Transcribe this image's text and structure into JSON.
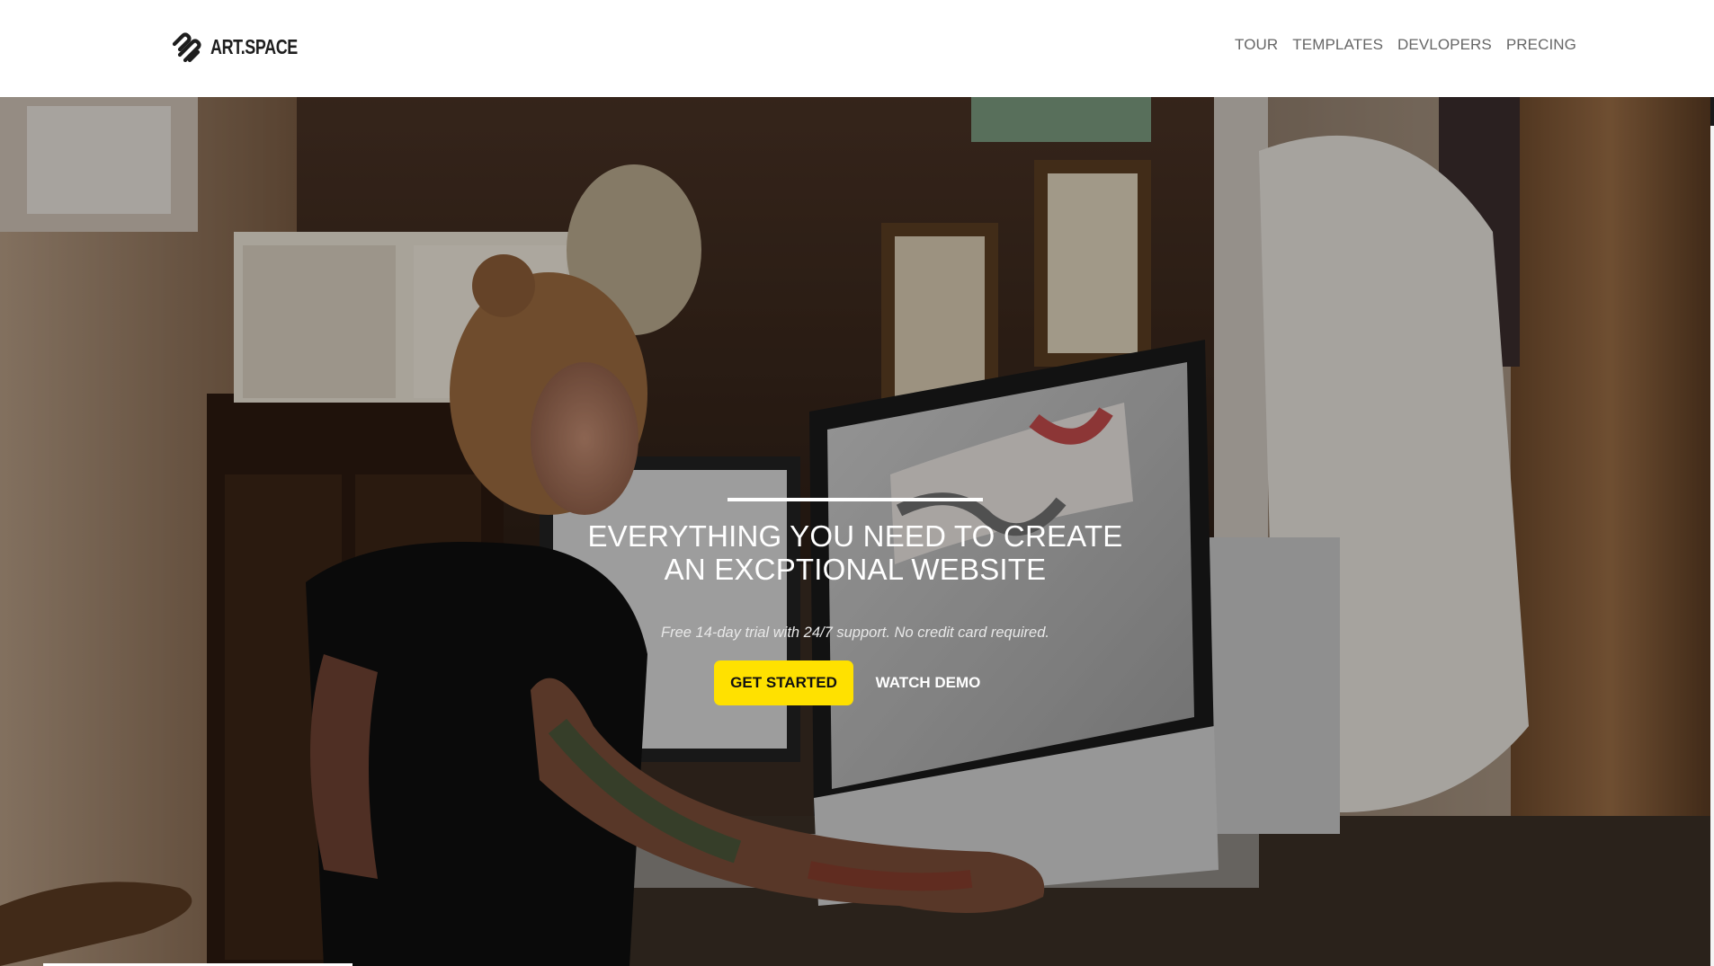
{
  "brand": {
    "name": "ART.SPACE",
    "logo_icon": "artspace-logo-icon"
  },
  "nav": {
    "items": [
      {
        "label": "TOUR"
      },
      {
        "label": "TEMPLATES"
      },
      {
        "label": "DEVLOPERS"
      },
      {
        "label": "PRECING"
      }
    ]
  },
  "hero": {
    "title_line1": "EVERYTHING YOU NEED TO CREATE",
    "title_line2": "AN EXCPTIONAL WEBSITE",
    "subtitle": "Free 14-day trial with 24/7 support. No credit card required.",
    "primary_cta": "GET STARTED",
    "secondary_cta": "WATCH DEMO",
    "background_image": "artist-drawing-at-desk-with-imac"
  },
  "colors": {
    "accent": "#ffe100",
    "nav_text": "#666666",
    "hero_text": "#ffffff"
  }
}
